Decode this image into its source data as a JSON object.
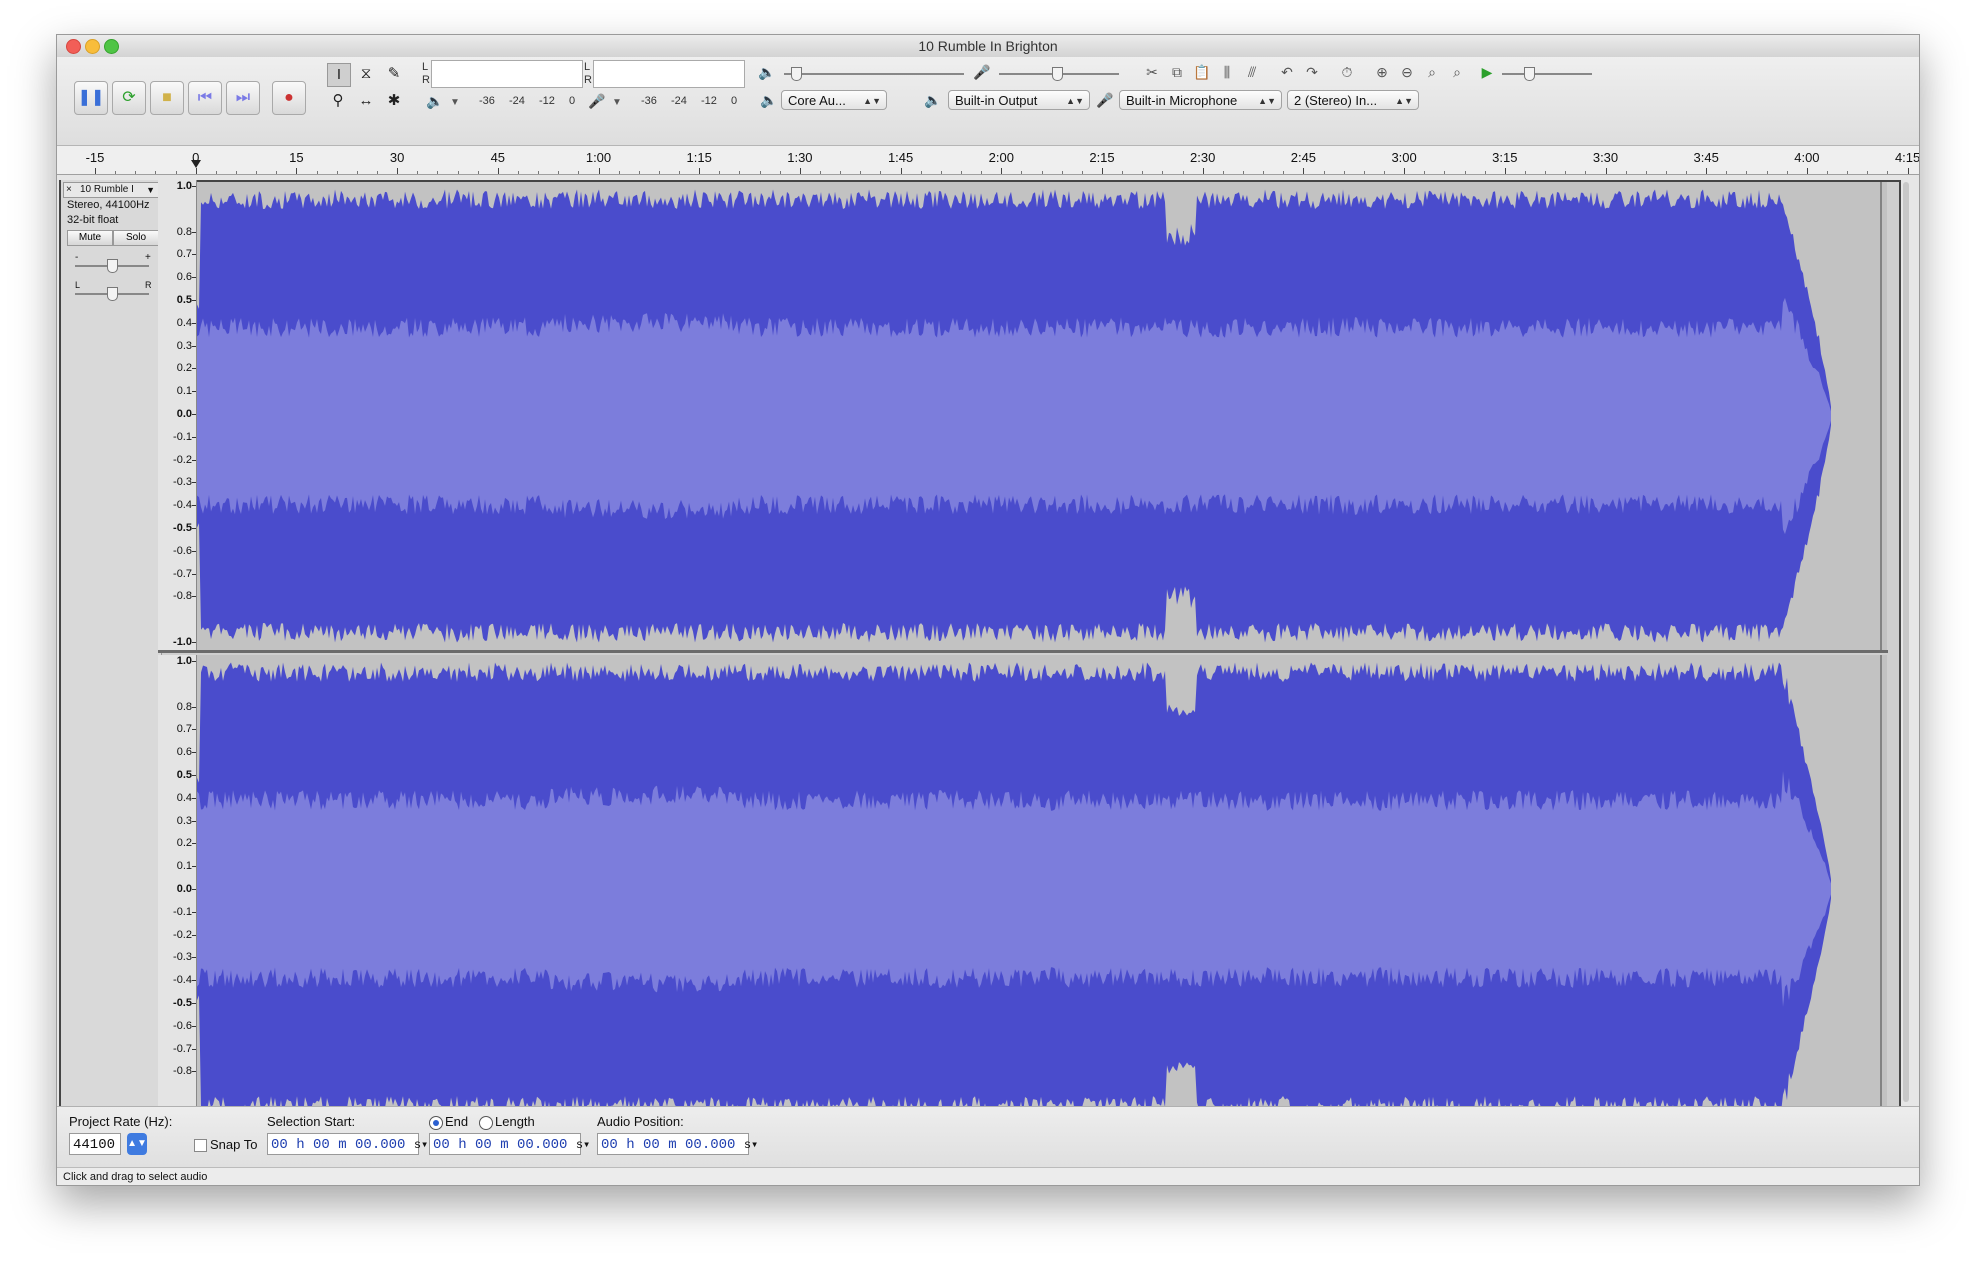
{
  "window": {
    "title": "10 Rumble In Brighton"
  },
  "transport": {
    "pause": "pause-button",
    "play": "play-button",
    "stop": "stop-button",
    "skip_start": "skip-start-button",
    "skip_end": "skip-end-button",
    "record": "record-button"
  },
  "meters": {
    "playback_scale": [
      "-36",
      "-24",
      "-12",
      "0"
    ],
    "record_scale": [
      "-36",
      "-24",
      "-12",
      "0"
    ],
    "channel_l": "L",
    "channel_r": "R"
  },
  "devices": {
    "host": "Core Au...",
    "output": "Built-in Output",
    "input": "Built-in Microphone",
    "channels": "2 (Stereo) In..."
  },
  "timeline": {
    "ticks": [
      "-15",
      "0",
      "15",
      "30",
      "45",
      "1:00",
      "1:15",
      "1:30",
      "1:45",
      "2:00",
      "2:15",
      "2:30",
      "2:45",
      "3:00",
      "3:15",
      "3:30",
      "3:45",
      "4:00",
      "4:15"
    ]
  },
  "track": {
    "name": "10 Rumble I",
    "close": "×",
    "format": "Stereo, 44100Hz",
    "bit_depth": "32-bit float",
    "mute": "Mute",
    "solo": "Solo",
    "gain_minus": "-",
    "gain_plus": "+",
    "pan_l": "L",
    "pan_r": "R",
    "scale": [
      "1.0",
      "0.8",
      "0.7",
      "0.6",
      "0.5",
      "0.4",
      "0.3",
      "0.2",
      "0.1",
      "0.0",
      "-0.1",
      "-0.2",
      "-0.3",
      "-0.4",
      "-0.5",
      "-0.6",
      "-0.7",
      "-0.8",
      "-1.0"
    ]
  },
  "colors": {
    "wave_dark": "#4a4ccc",
    "wave_light": "#7c7ddc",
    "background": "#c2c2c2"
  },
  "selection_bar": {
    "project_rate_label": "Project Rate (Hz):",
    "project_rate_value": "44100",
    "snap_to_label": "Snap To",
    "selection_start_label": "Selection Start:",
    "end_label": "End",
    "length_label": "Length",
    "audio_position_label": "Audio Position:",
    "selection_start_value": "00 h 00 m 00.000",
    "selection_end_value": "00 h 00 m 00.000",
    "audio_position_value": "00 h 00 m 00.000",
    "unit": "s"
  },
  "status": {
    "text": "Click and drag to select audio"
  }
}
